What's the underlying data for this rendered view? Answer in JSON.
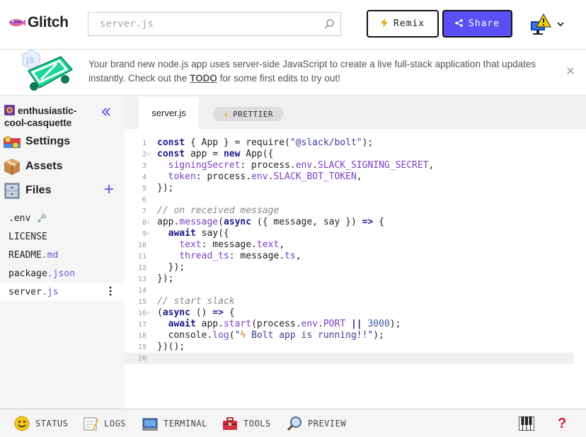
{
  "header": {
    "logo_text": "Glitch",
    "search_placeholder": "server.js",
    "remix_label": "Remix",
    "share_label": "Share"
  },
  "banner": {
    "text_before": "Your brand new node.js app uses server-side JavaScript to create a live full-stack application that updates instantly. Check out the ",
    "todo": "TODO",
    "text_after": " for some first edits to try out!"
  },
  "sidebar": {
    "project_name": "enthusiastic-cool-casquette",
    "items": [
      {
        "label": "Settings"
      },
      {
        "label": "Assets"
      },
      {
        "label": "Files"
      }
    ],
    "files": [
      {
        "base": ".env",
        "ext": "",
        "extra": "🗝️"
      },
      {
        "base": "LICENSE",
        "ext": ""
      },
      {
        "base": "README",
        "ext": ".md"
      },
      {
        "base": "package",
        "ext": ".json"
      },
      {
        "base": "server",
        "ext": ".js"
      }
    ]
  },
  "editor": {
    "tab_label": "server.js",
    "prettier_label": "PRETTIER",
    "line_numbers": [
      "1",
      "2",
      "3",
      "4",
      "5",
      "6",
      "7",
      "8",
      "9",
      "10",
      "11",
      "12",
      "13",
      "14",
      "15",
      "16",
      "17",
      "18",
      "19",
      "20"
    ]
  },
  "footer": {
    "status": "STATUS",
    "logs": "LOGS",
    "terminal": "TERMINAL",
    "tools": "TOOLS",
    "preview": "PREVIEW",
    "help": "?"
  },
  "colors": {
    "accent": "#5a4ff3",
    "sidebar_bg": "#f5f5f5",
    "help": "#e0102a"
  }
}
